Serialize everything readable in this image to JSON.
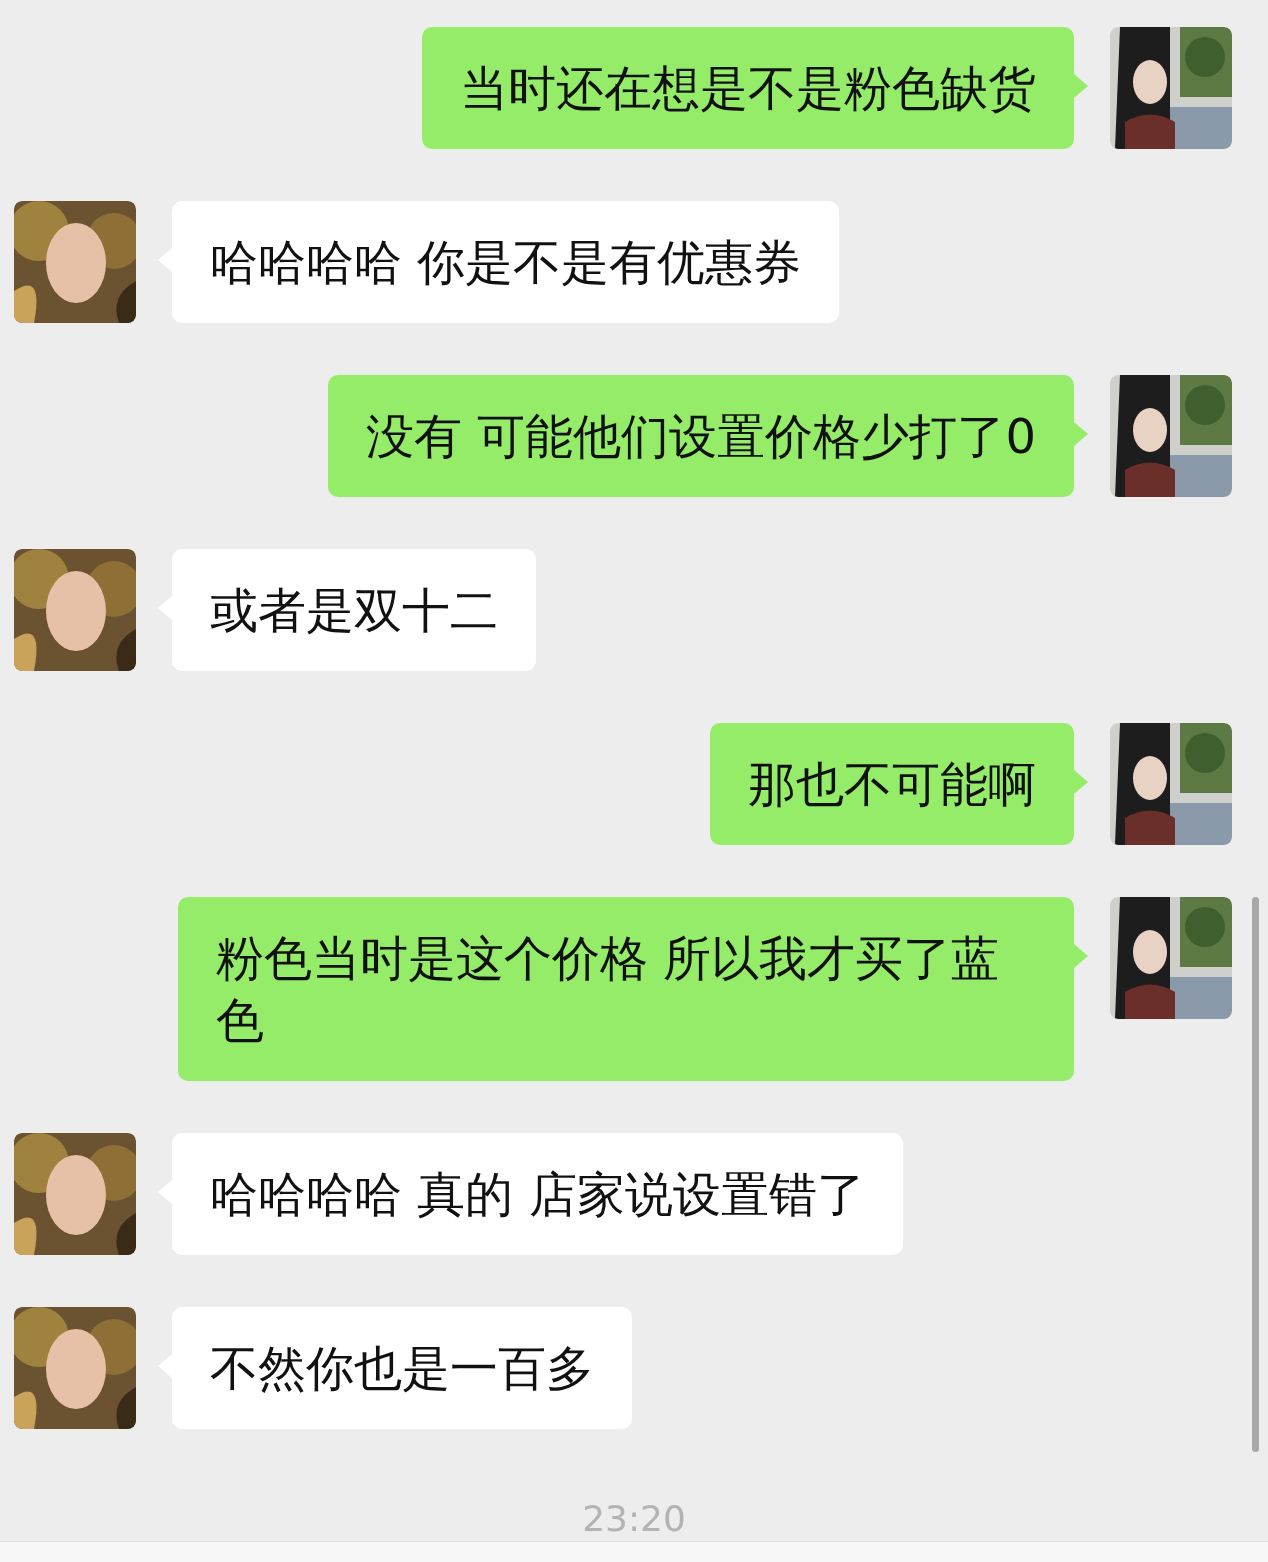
{
  "messages": [
    {
      "kind": "sent",
      "text": "当时还在想是不是粉色缺货"
    },
    {
      "kind": "received",
      "text": "哈哈哈哈 你是不是有优惠券"
    },
    {
      "kind": "sent",
      "text": "没有 可能他们设置价格少打了0"
    },
    {
      "kind": "received",
      "text": "或者是双十二"
    },
    {
      "kind": "sent",
      "text": "那也不可能啊"
    },
    {
      "kind": "sent",
      "text": "粉色当时是这个价格 所以我才买了蓝色"
    },
    {
      "kind": "received",
      "text": "哈哈哈哈 真的 店家说设置错了"
    },
    {
      "kind": "received",
      "text": "不然你也是一百多"
    }
  ],
  "timestamp": "23:20"
}
